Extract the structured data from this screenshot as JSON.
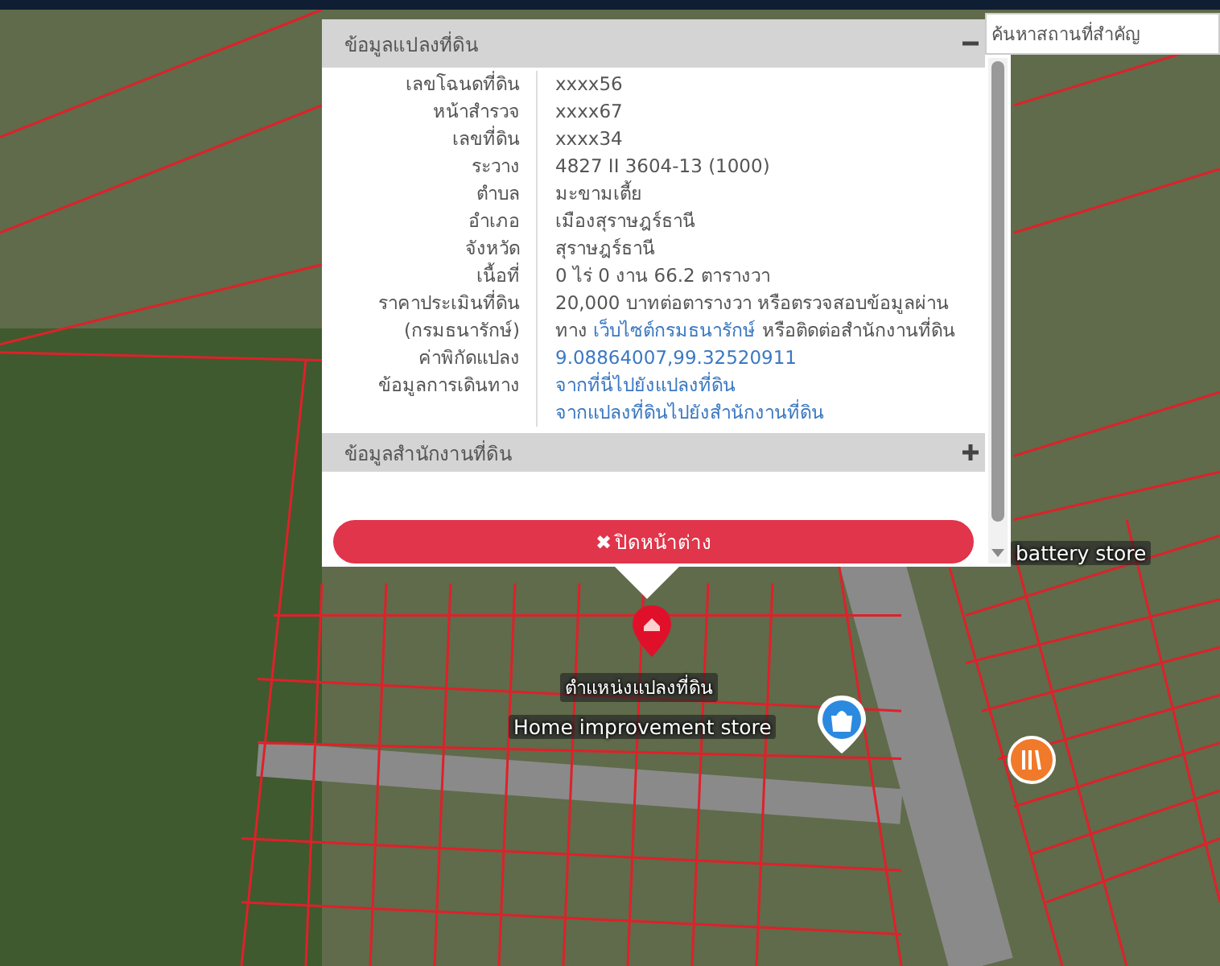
{
  "search": {
    "placeholder": "ค้นหาสถานที่สำคัญ"
  },
  "popup": {
    "sections": [
      {
        "title": "ข้อมูลแปลงที่ดิน",
        "expanded": true,
        "rows": [
          {
            "label": [
              "เลขโฉนดที่ดิน"
            ],
            "lines": [
              [
                {
                  "kind": "text",
                  "text": "xxxx56"
                }
              ]
            ]
          },
          {
            "label": [
              "หน้าสำรวจ"
            ],
            "lines": [
              [
                {
                  "kind": "text",
                  "text": "xxxx67"
                }
              ]
            ]
          },
          {
            "label": [
              "เลขที่ดิน"
            ],
            "lines": [
              [
                {
                  "kind": "text",
                  "text": "xxxx34"
                }
              ]
            ]
          },
          {
            "label": [
              "ระวาง"
            ],
            "lines": [
              [
                {
                  "kind": "text",
                  "text": "4827 II 3604-13 (1000)"
                }
              ]
            ]
          },
          {
            "label": [
              "ตำบล"
            ],
            "lines": [
              [
                {
                  "kind": "text",
                  "text": "มะขามเตี้ย"
                }
              ]
            ]
          },
          {
            "label": [
              "อำเภอ"
            ],
            "lines": [
              [
                {
                  "kind": "text",
                  "text": "เมืองสุราษฎร์ธานี"
                }
              ]
            ]
          },
          {
            "label": [
              "จังหวัด"
            ],
            "lines": [
              [
                {
                  "kind": "text",
                  "text": "สุราษฎร์ธานี"
                }
              ]
            ]
          },
          {
            "label": [
              "เนื้อที่"
            ],
            "lines": [
              [
                {
                  "kind": "text",
                  "text": "0 ไร่ 0 งาน 66.2 ตารางวา"
                }
              ]
            ]
          },
          {
            "label": [
              "ราคาประเมินที่ดิน",
              "(กรมธนารักษ์)"
            ],
            "lines": [
              [
                {
                  "kind": "text",
                  "text": "20,000 บาทต่อตารางวา หรือตรวจสอบข้อมูลผ่านทาง "
                },
                {
                  "kind": "link",
                  "text": "เว็บไซต์กรมธนารักษ์"
                },
                {
                  "kind": "text",
                  "text": " หรือติดต่อสำนักงานที่ดิน"
                }
              ]
            ]
          },
          {
            "label": [
              "ค่าพิกัดแปลง"
            ],
            "lines": [
              [
                {
                  "kind": "link",
                  "text": "9.08864007,99.32520911"
                }
              ]
            ]
          },
          {
            "label": [
              "ข้อมูลการเดินทาง"
            ],
            "lines": [
              [
                {
                  "kind": "link",
                  "text": "จากที่นี่ไปยังแปลงที่ดิน"
                }
              ],
              [
                {
                  "kind": "link",
                  "text": "จากแปลงที่ดินไปยังสำนักงานที่ดิน"
                }
              ]
            ]
          }
        ]
      },
      {
        "title": "ข้อมูลสำนักงานที่ดิน",
        "expanded": false
      }
    ],
    "close_button": {
      "icon": "✖",
      "label": "ปิดหน้าต่าง"
    }
  },
  "map": {
    "marker_label": "ตำแหน่งแปลงที่ดิน",
    "places": [
      {
        "kind": "plain",
        "label": "battery store"
      },
      {
        "kind": "shop",
        "label": "Home improvement store"
      }
    ]
  }
}
